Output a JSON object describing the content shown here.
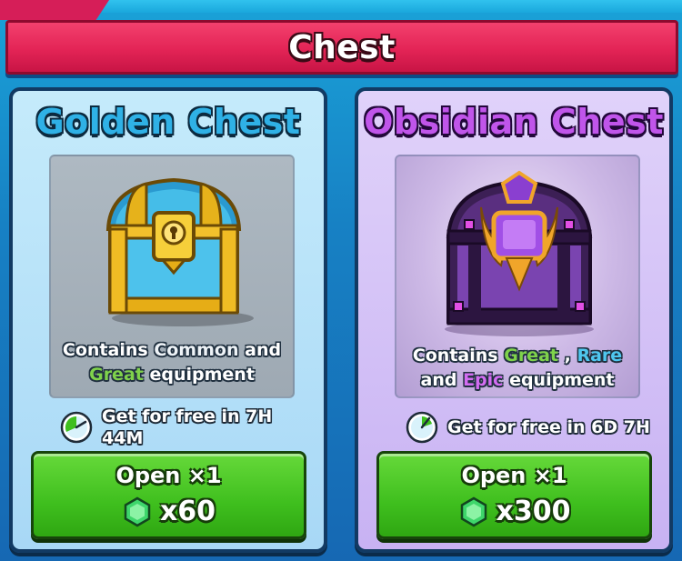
{
  "header": {
    "title": "Chest"
  },
  "colors": {
    "banner": "#e32456",
    "golden_title": "#2fb1e6",
    "obsidian_title": "#c055ea",
    "button_green": "#3fbf1e",
    "great": "#7fd24b",
    "rare": "#4fc7ef",
    "epic": "#d36df2"
  },
  "chests": [
    {
      "name": "Golden Chest",
      "icon": "golden-chest-icon",
      "contains": {
        "prefix": "Contains",
        "word1": "Common",
        "conj": "and",
        "word2": "Great",
        "suffix": "equipment"
      },
      "timer": {
        "icon": "timer-icon",
        "text": "Get for free in 7H 44M"
      },
      "button": {
        "label": "Open ×1",
        "gem_icon": "gem-icon",
        "price": "x60"
      }
    },
    {
      "name": "Obsidian Chest",
      "icon": "obsidian-chest-icon",
      "contains": {
        "prefix": "Contains",
        "word1": "Great",
        "sep": ",",
        "word2": "Rare",
        "conj": "and",
        "word3": "Epic",
        "suffix": "equipment"
      },
      "timer": {
        "icon": "timer-icon",
        "text": "Get for free in 6D 7H"
      },
      "button": {
        "label": "Open ×1",
        "gem_icon": "gem-icon",
        "price": "x300"
      }
    }
  ]
}
